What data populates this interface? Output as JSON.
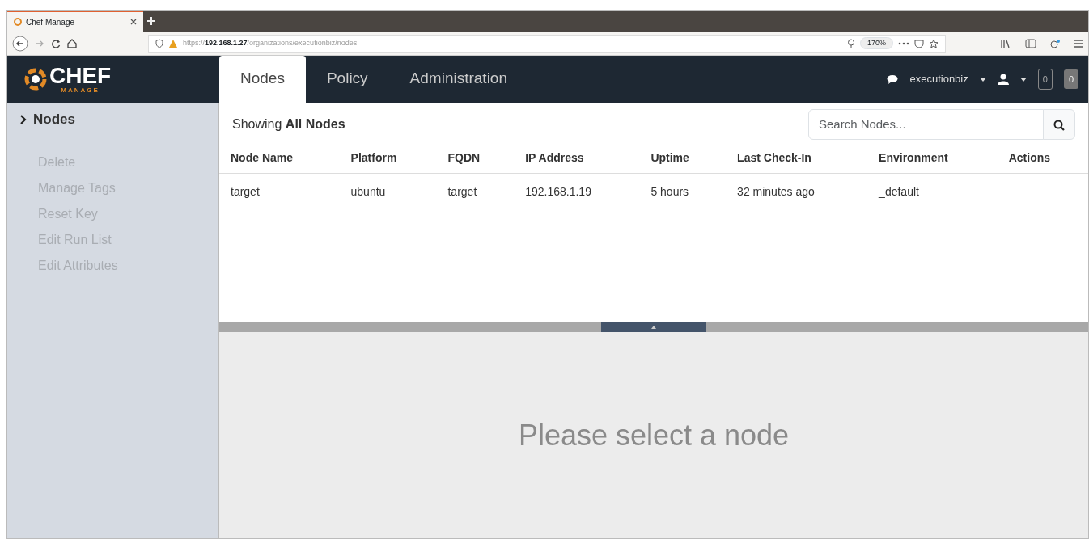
{
  "browser": {
    "tab_title": "Chef Manage",
    "url_host": "https://192.168.1.27",
    "url_path": "/organizations/executionbiz/nodes",
    "zoom": "170%"
  },
  "logo": {
    "name": "CHEF",
    "subtitle": "MANAGE"
  },
  "tabs": [
    {
      "label": "Nodes",
      "selected": true
    },
    {
      "label": "Policy",
      "selected": false
    },
    {
      "label": "Administration",
      "selected": false
    }
  ],
  "navbar": {
    "org": "executionbiz",
    "counter_1": "0",
    "counter_2": "0"
  },
  "sidebar": {
    "heading": "Nodes",
    "items": [
      {
        "label": "Delete",
        "disabled": true
      },
      {
        "label": "Manage Tags",
        "disabled": true
      },
      {
        "label": "Reset Key",
        "disabled": true
      },
      {
        "label": "Edit Run List",
        "disabled": true
      },
      {
        "label": "Edit Attributes",
        "disabled": true
      }
    ]
  },
  "list": {
    "showing": "Showing **All Nodes**",
    "search": {
      "placeholder": "Search Nodes..."
    }
  },
  "table": {
    "columns": [
      "Node Name",
      "Platform",
      "FQDN",
      "IP Address",
      "Uptime",
      "Last Check-In",
      "Environment",
      "Actions"
    ],
    "rows": [
      [
        "target",
        "ubuntu",
        "target",
        "192.168.1.19",
        "5 hours",
        "32 minutes ago",
        "_default",
        ""
      ]
    ]
  },
  "detail": {
    "message": "Please select a node"
  }
}
